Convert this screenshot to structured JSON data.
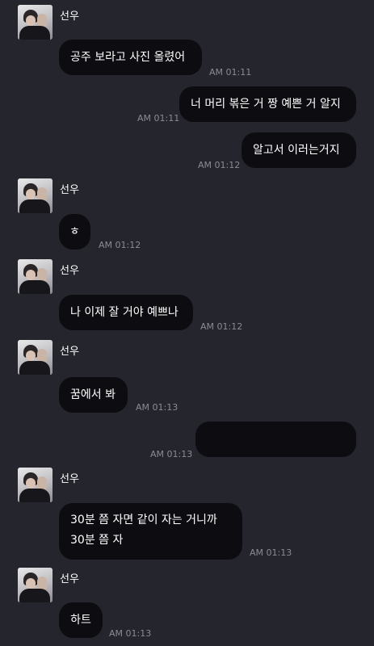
{
  "sender": "선우",
  "messages": [
    {
      "text": "공주 보라고 사진 올렸어",
      "time": "AM 01:11"
    },
    {
      "text": "너 머리 볶은 거 짱 예쁜 거 알지",
      "time": "AM 01:11"
    },
    {
      "text": "알고서 이러는거지",
      "time": "AM 01:12"
    },
    {
      "text": "ㅎ",
      "time": "AM 01:12"
    },
    {
      "text": "나 이제 잘 거야 예쁘나",
      "time": "AM 01:12"
    },
    {
      "text": "꿈에서 봐",
      "time": "AM 01:13"
    },
    {
      "text": "",
      "time": "AM 01:13"
    },
    {
      "text": "30분 쯤 자면 같이 자는 거니까 30분 쯤 자",
      "time": "AM 01:13"
    },
    {
      "text": "하트",
      "time": "AM 01:13"
    }
  ]
}
